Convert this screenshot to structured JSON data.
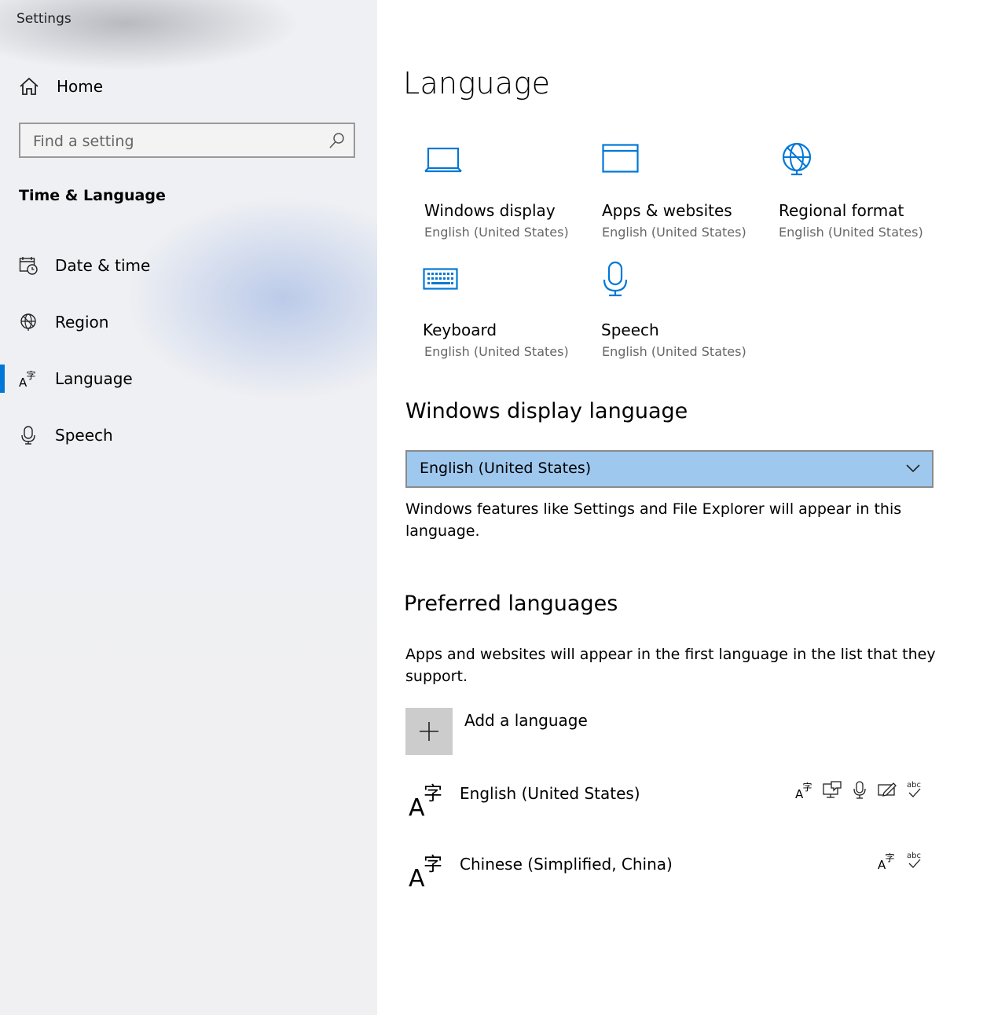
{
  "app": {
    "title": "Settings"
  },
  "sidebar": {
    "home_label": "Home",
    "search_placeholder": "Find a setting",
    "section_title": "Time & Language",
    "items": [
      {
        "label": "Date & time",
        "icon": "calendar-clock-icon"
      },
      {
        "label": "Region",
        "icon": "globe-icon"
      },
      {
        "label": "Language",
        "icon": "language-icon",
        "active": true
      },
      {
        "label": "Speech",
        "icon": "microphone-icon"
      }
    ]
  },
  "main": {
    "title": "Language",
    "tiles": [
      {
        "title": "Windows display",
        "subtitle": "English (United States)",
        "icon": "laptop-icon"
      },
      {
        "title": "Apps & websites",
        "subtitle": "English (United States)",
        "icon": "window-icon"
      },
      {
        "title": "Regional format",
        "subtitle": "English (United States)",
        "icon": "globe-icon"
      },
      {
        "title": "Keyboard",
        "subtitle": "English (United States)",
        "icon": "keyboard-icon"
      },
      {
        "title": "Speech",
        "subtitle": "English (United States)",
        "icon": "microphone-icon"
      }
    ],
    "display_language": {
      "heading": "Windows display language",
      "selected": "English (United States)",
      "description": "Windows features like Settings and File Explorer will appear in this language."
    },
    "preferred": {
      "heading": "Preferred languages",
      "description": "Apps and websites will appear in the first language in the list that they support.",
      "add_label": "Add a language",
      "languages": [
        {
          "name": "English (United States)",
          "features": [
            "language-pack-icon",
            "display-icon",
            "speech-icon",
            "handwriting-icon",
            "spelling-icon"
          ]
        },
        {
          "name": "Chinese (Simplified, China)",
          "features": [
            "language-pack-icon",
            "spelling-icon"
          ]
        }
      ]
    }
  },
  "colors": {
    "accent": "#0078d7",
    "dropdown_bg": "#9ec8ee",
    "secondary_text": "#666666"
  }
}
